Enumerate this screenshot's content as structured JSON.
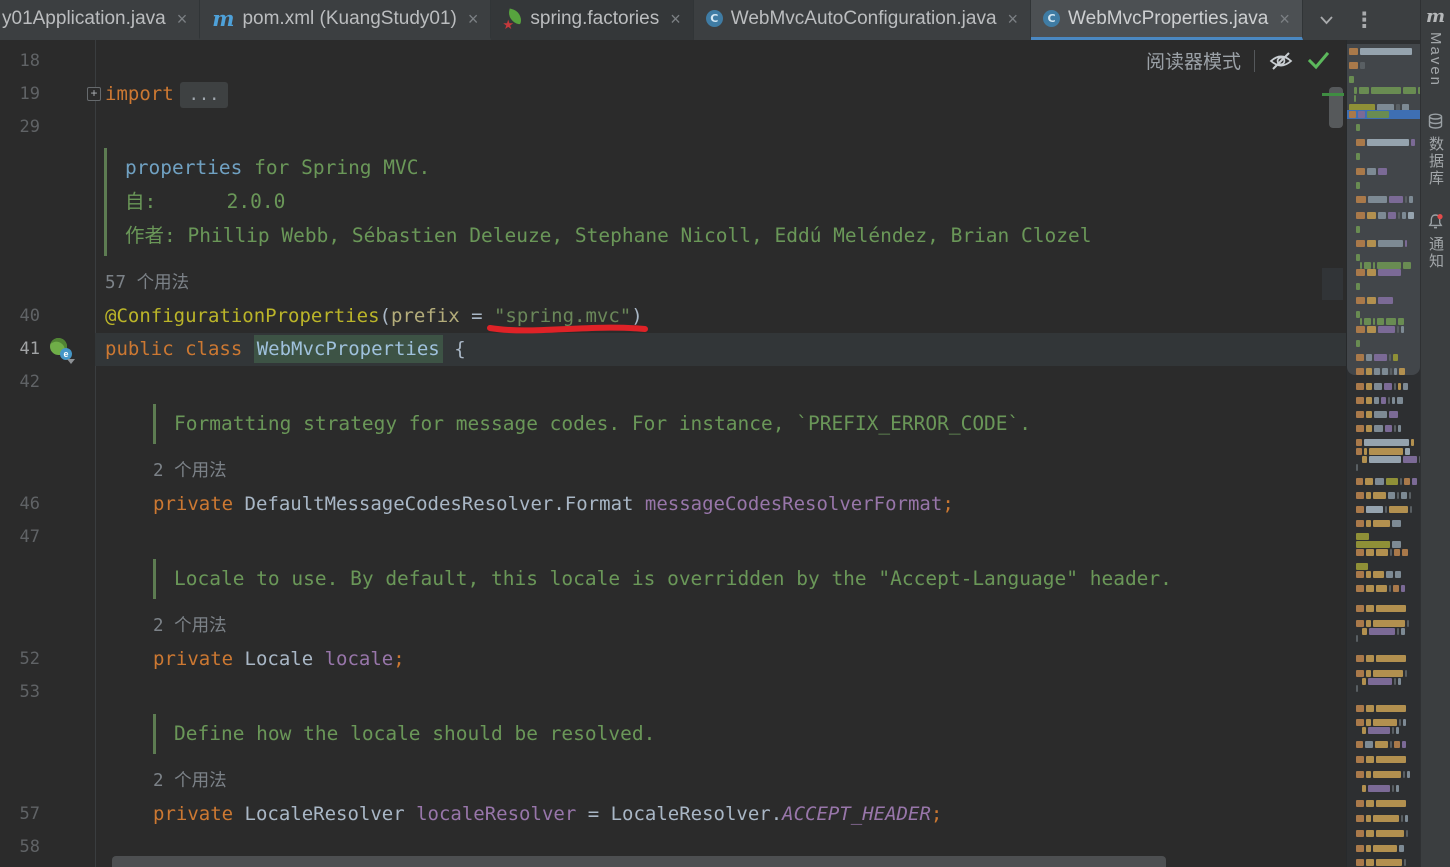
{
  "tab_bar": {
    "close_glyph": "×",
    "kebab_glyph": "⋮",
    "tabs": [
      {
        "label": "y01Application.java",
        "icon": "none",
        "clipped": true
      },
      {
        "label": "pom.xml (KuangStudy01)",
        "icon": "maven"
      },
      {
        "label": "spring.factories",
        "icon": "spring-boot",
        "shaded": true
      },
      {
        "label": "WebMvcAutoConfiguration.java",
        "icon": "java-class"
      },
      {
        "label": "WebMvcProperties.java",
        "icon": "java-class",
        "active": true
      }
    ]
  },
  "editor_header": {
    "reader_mode_label": "阅读器模式",
    "icons": [
      "eye-off-icon",
      "inspections-ok-icon"
    ]
  },
  "gutter": {
    "fold_glyph": "+",
    "spring_badge": "e"
  },
  "code": {
    "rows": [
      {
        "type": "code",
        "num": "18",
        "tokens": []
      },
      {
        "type": "code",
        "num": "19",
        "fold": true,
        "tokens": [
          {
            "c": "kw",
            "t": "import"
          },
          {
            "c": "folded",
            "t": "..."
          }
        ]
      },
      {
        "type": "code",
        "num": "29",
        "tokens": []
      },
      {
        "type": "doc",
        "indent": 0,
        "lines": [
          [
            {
              "c": "docref",
              "t": "properties"
            },
            {
              "c": "doc",
              "t": " for Spring MVC."
            }
          ],
          [
            {
              "c": "doc",
              "t": "自:      2.0.0"
            }
          ],
          [
            {
              "c": "doc",
              "t": "作者: Phillip Webb, Sébastien Deleuze, Stephane Nicoll, Eddú Meléndez, Brian Clozel"
            }
          ]
        ]
      },
      {
        "type": "usages",
        "indent": 0,
        "text": "57 个用法"
      },
      {
        "type": "code",
        "num": "40",
        "tokens": [
          {
            "c": "ann",
            "t": "@ConfigurationProperties"
          },
          {
            "c": "pl",
            "t": "("
          },
          {
            "c": "attr",
            "t": "prefix"
          },
          {
            "c": "pl",
            "t": " = "
          },
          {
            "c": "str",
            "t": "\"spring.mvc\"",
            "marker": true
          },
          {
            "c": "pl",
            "t": ")"
          }
        ]
      },
      {
        "type": "code",
        "num": "41",
        "current": true,
        "gicon": "spring",
        "tokens": [
          {
            "c": "kw",
            "t": "public class "
          },
          {
            "c": "cls",
            "t": "WebMvcProperties",
            "hl": true
          },
          {
            "c": "pl",
            "t": " {"
          }
        ]
      },
      {
        "type": "code",
        "num": "42",
        "tokens": []
      },
      {
        "type": "doc",
        "indent": 1,
        "lines": [
          [
            {
              "c": "doc",
              "t": "Formatting strategy for message codes. For instance, `PREFIX_ERROR_CODE`."
            }
          ]
        ]
      },
      {
        "type": "usages",
        "indent": 1,
        "text": "2 个用法"
      },
      {
        "type": "code",
        "num": "46",
        "indent": 1,
        "tokens": [
          {
            "c": "kw",
            "t": "private"
          },
          {
            "c": "pl",
            "t": " DefaultMessageCodesResolver.Format "
          },
          {
            "c": "fld",
            "t": "messageCodesResolverFormat"
          },
          {
            "c": "semi",
            "t": ";"
          }
        ]
      },
      {
        "type": "code",
        "num": "47",
        "tokens": []
      },
      {
        "type": "doc",
        "indent": 1,
        "lines": [
          [
            {
              "c": "doc",
              "t": "Locale to use. By default, this locale is overridden by the \"Accept-Language\" header."
            }
          ]
        ]
      },
      {
        "type": "usages",
        "indent": 1,
        "text": "2 个用法"
      },
      {
        "type": "code",
        "num": "52",
        "indent": 1,
        "tokens": [
          {
            "c": "kw",
            "t": "private"
          },
          {
            "c": "pl",
            "t": " Locale "
          },
          {
            "c": "fld",
            "t": "locale"
          },
          {
            "c": "semi",
            "t": ";"
          }
        ]
      },
      {
        "type": "code",
        "num": "53",
        "tokens": []
      },
      {
        "type": "doc",
        "indent": 1,
        "lines": [
          [
            {
              "c": "doc",
              "t": "Define how the locale should be resolved."
            }
          ]
        ]
      },
      {
        "type": "usages",
        "indent": 1,
        "text": "2 个用法"
      },
      {
        "type": "code",
        "num": "57",
        "indent": 1,
        "tokens": [
          {
            "c": "kw",
            "t": "private"
          },
          {
            "c": "pl",
            "t": " LocaleResolver "
          },
          {
            "c": "fld",
            "t": "localeResolver"
          },
          {
            "c": "pl",
            "t": " = LocaleResolver."
          },
          {
            "c": "sfld",
            "t": "ACCEPT_HEADER"
          },
          {
            "c": "semi",
            "t": ";"
          }
        ]
      },
      {
        "type": "code",
        "num": "58",
        "tokens": []
      }
    ]
  },
  "annotation_marker": {
    "color": "#df2227",
    "under_text": "\"spring.mvc\""
  },
  "right_bar": {
    "items": [
      {
        "icon": "maven-icon",
        "label": "Maven"
      },
      {
        "icon": "database-icon",
        "label": "数据库"
      },
      {
        "icon": "bell-icon",
        "label": "通知",
        "badge": true
      }
    ]
  },
  "colors": {
    "editor_bg": "#2b2b2b",
    "tab_bg": "#3c3f41",
    "active_tab_bg": "#4c5053",
    "active_tab_underline": "#4a88c2",
    "keyword": "#cc7832",
    "annotation": "#bbb529",
    "string": "#6a8759",
    "field": "#9876aa",
    "doc_comment": "#6a9758",
    "doc_code_ref": "#70a1c2",
    "line_number": "#606366",
    "current_line_bg": "#323638",
    "identifier_highlight_bg": "#3d5345",
    "inspection_ok_green": "#5cb85c"
  },
  "minimap": {
    "palette": {
      "o": "#a9794a",
      "t": "#b2904f",
      "g": "#7d8a94",
      "b": "#95a3ae",
      "G": "#698c52",
      "O": "#8f9037",
      "p": "#7b6a96",
      "d": "#595f63"
    },
    "selection_color": "#3e6fb3",
    "rows": [
      [
        48,
        0,
        "o9 b52"
      ],
      [
        62,
        0,
        "o9 d5"
      ],
      [
        76,
        0,
        "G5"
      ],
      [
        87,
        5,
        "G3 G10 G30 G13 G5"
      ],
      [
        95,
        5,
        "G2"
      ],
      [
        104,
        0,
        "O26 g17 d4 g7"
      ],
      [
        111,
        0,
        "o7 p7 G22",
        "bar"
      ],
      [
        124,
        7,
        "G4"
      ],
      [
        139,
        7,
        "o9 b42 p4"
      ],
      [
        153,
        7,
        "G4"
      ],
      [
        168,
        7,
        "o9 g9 p9"
      ],
      [
        182,
        7,
        "G4"
      ],
      [
        196,
        7,
        "o10 g19 p14 d2 g4"
      ],
      [
        212,
        7,
        "o9 t9 g8 p8 d2 g4 b6"
      ],
      [
        226,
        7,
        "G4"
      ],
      [
        240,
        7,
        "o9 t9 g25 p2"
      ],
      [
        254,
        7,
        "G4"
      ],
      [
        262,
        11,
        "G2 G7 G2 G24 G8"
      ],
      [
        269,
        7,
        "o9 t9 p23"
      ],
      [
        283,
        7,
        "G4"
      ],
      [
        297,
        7,
        "o9 t9 p15"
      ],
      [
        311,
        7,
        "G4"
      ],
      [
        318,
        11,
        "G2 G7 G2 G7 G10 G6"
      ],
      [
        326,
        7,
        "o9 t9 p17 d2 g3"
      ],
      [
        340,
        7,
        "G4"
      ],
      [
        354,
        7,
        "o8 g6 p13 d2 O5"
      ],
      [
        368,
        7,
        "o8 t6 g6 g6 d2 g3 t6"
      ],
      [
        383,
        7,
        "o8 t6 g8 p8 d2 t3 g5"
      ],
      [
        397,
        7,
        "o8 t6 g5 p5 d2 g3 g6"
      ],
      [
        411,
        7,
        "o8 t6 g13 p9"
      ],
      [
        425,
        7,
        "o8 t6 g9 p7 d2 g3"
      ],
      [
        439,
        7,
        "o6 b45 t3"
      ],
      [
        448,
        7,
        "o6 t3 t34 b5"
      ],
      [
        456,
        13,
        "t5 b32 p14 d2 g4"
      ],
      [
        464,
        7,
        "d2"
      ],
      [
        478,
        7,
        "o7 t8 g9 O12 d2 o6 p5"
      ],
      [
        492,
        7,
        "o8 t5 t13 g7 d2 g6 d2"
      ],
      [
        506,
        7,
        "o8 b17 d2 t19 d2"
      ],
      [
        520,
        7,
        "o8 t5 t17 g9"
      ],
      [
        533,
        7,
        "O13"
      ],
      [
        541,
        7,
        "O34 g9"
      ],
      [
        549,
        7,
        "o8 t8 t12 d2 o6 o6"
      ],
      [
        563,
        7,
        "O12"
      ],
      [
        571,
        7,
        "o8 t5 t11 g7 g6"
      ],
      [
        585,
        7,
        "o8 t8 t11 d2 o6 p4"
      ],
      [
        605,
        7,
        "o8 t8 t30"
      ],
      [
        620,
        7,
        "o8 t5 t32 d2"
      ],
      [
        628,
        13,
        "t5 p26 d2 g4"
      ],
      [
        635,
        7,
        "d2"
      ],
      [
        655,
        7,
        "o8 t8 t30"
      ],
      [
        670,
        7,
        "o8 t5 t30 d2"
      ],
      [
        678,
        13,
        "t4 p24 d2 g3"
      ],
      [
        685,
        7,
        "d2"
      ],
      [
        705,
        7,
        "o8 t8 t30"
      ],
      [
        719,
        7,
        "o8 t5 t24 d2 g3"
      ],
      [
        727,
        13,
        "t4 p22 d2 g3"
      ],
      [
        741,
        7,
        "o7 g8 t13 d2 o6 p4"
      ],
      [
        756,
        7,
        "o8 t8 t30"
      ],
      [
        771,
        7,
        "o8 t5 t28 d2 g3"
      ],
      [
        785,
        13,
        "t4 p22 d2 g3"
      ],
      [
        800,
        7,
        "o8 t8 t30"
      ],
      [
        815,
        7,
        "o8 t5 t26 d2 g3"
      ],
      [
        830,
        7,
        "o8 t8 t28 d2"
      ],
      [
        845,
        7,
        "o8 t5 t24 g5"
      ],
      [
        859,
        7,
        "o8 t8 t26 d2"
      ]
    ]
  }
}
